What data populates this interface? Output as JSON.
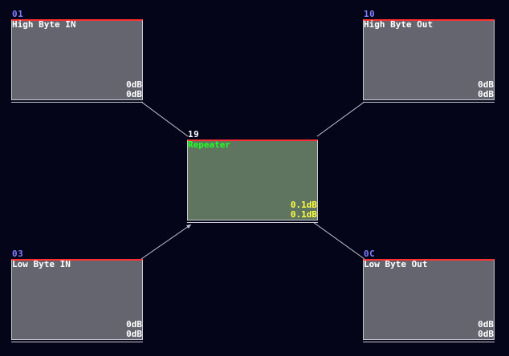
{
  "nodes": {
    "high_in": {
      "id": "01",
      "title": "High Byte IN",
      "level1": "0dB",
      "level2": "0dB"
    },
    "high_out": {
      "id": "10",
      "title": "High Byte Out",
      "level1": "0dB",
      "level2": "0dB"
    },
    "repeater": {
      "id": "19",
      "title": "Repeater",
      "level1": "0.1dB",
      "level2": "0.1dB"
    },
    "low_in": {
      "id": "03",
      "title": "Low Byte IN",
      "level1": "0dB",
      "level2": "0dB"
    },
    "low_out": {
      "id": "0C",
      "title": "Low Byte Out",
      "level1": "0dB",
      "level2": "0dB"
    }
  },
  "colors": {
    "background": "#05051a",
    "node_fill": "#65656f",
    "center_fill": "#5f7560",
    "title_bar": "#ff3030",
    "id_label": "#7f7fff",
    "center_title": "#20ff20",
    "center_level": "#ffff40",
    "link_line": "#c8c8d0"
  }
}
